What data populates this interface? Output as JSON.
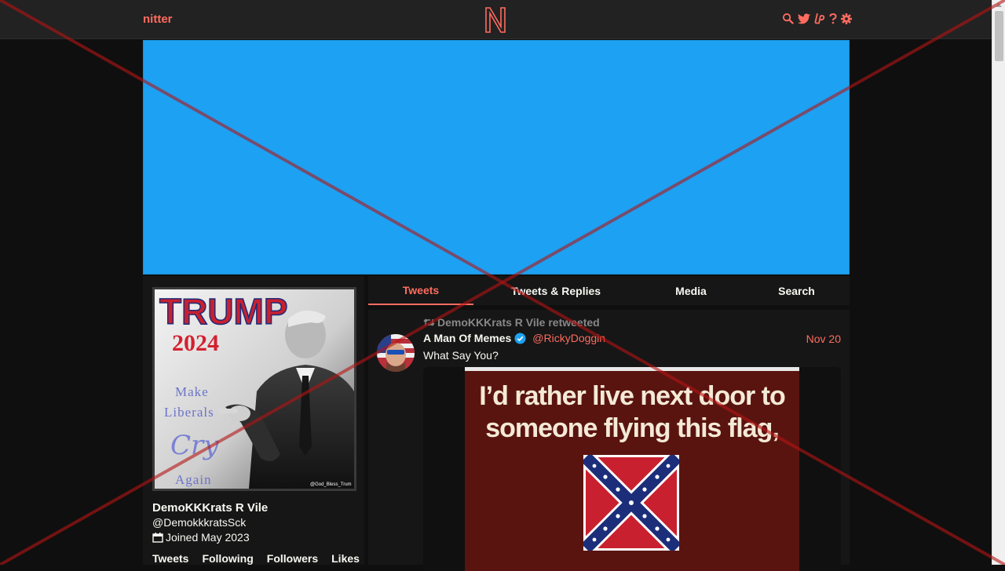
{
  "navbar": {
    "brand": "nitter",
    "logo_letter": "N",
    "icons": [
      "search-icon",
      "twitter-icon",
      "liberapay-icon",
      "help-icon",
      "gear-icon"
    ]
  },
  "banner": {
    "color": "#1da1f2"
  },
  "profile": {
    "fullname": "DemoKKKrats R Vile",
    "username": "@DemokkkratsSck",
    "join_date": "Joined May 2023",
    "avatar": {
      "line1": "TRUMP",
      "line2": "2024",
      "line3": "Make",
      "line4": "Liberals",
      "line5": "Cry",
      "line6": "Again",
      "watermark": "@God_Bless_Trum"
    },
    "stats": {
      "tweets": "Tweets",
      "following": "Following",
      "followers": "Followers",
      "likes": "Likes"
    }
  },
  "tabs": [
    {
      "label": "Tweets",
      "active": true
    },
    {
      "label": "Tweets & Replies",
      "active": false
    },
    {
      "label": "Media",
      "active": false
    },
    {
      "label": "Search",
      "active": false
    }
  ],
  "tweet": {
    "retweet_header": "DemoKKKrats R Vile retweeted",
    "fullname": "A Man Of Memes",
    "username": "@RickyDoggin",
    "date": "Nov 20",
    "content": "What Say You?",
    "image_text_line1": "I’d rather live next door to",
    "image_text_line2": "someone flying this flag,"
  },
  "colors": {
    "accent": "#ff6c60",
    "background": "#0f0f0f",
    "panel": "#161616",
    "navbar": "#222222",
    "text": "#f8f8f2",
    "muted": "#888889"
  }
}
